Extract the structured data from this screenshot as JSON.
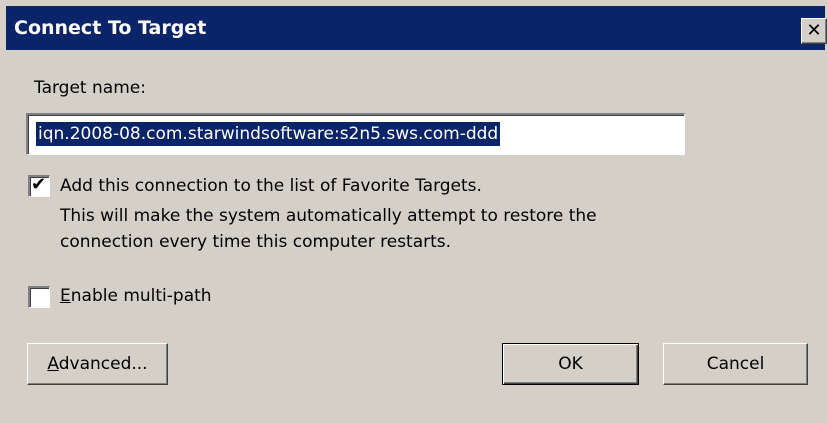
{
  "window": {
    "title": "Connect To Target",
    "close_glyph": "✕"
  },
  "target_name": {
    "label": "Target name:",
    "value": "iqn.2008-08.com.starwindsoftware:s2n5.sws.com-ddd"
  },
  "favorites": {
    "checked": true,
    "label": "Add this connection to the list of Favorite Targets.",
    "description_line1": "This will make the system automatically attempt to restore the",
    "description_line2": "connection every time this computer restarts."
  },
  "multipath": {
    "checked": false,
    "label_accel": "E",
    "label_rest": "nable multi-path"
  },
  "buttons": {
    "advanced_accel": "A",
    "advanced_rest": "dvanced...",
    "ok": "OK",
    "cancel": "Cancel"
  },
  "colors": {
    "face": "#d4d0c8",
    "title_bar": "#0a246a",
    "selection": "#0a246a"
  }
}
